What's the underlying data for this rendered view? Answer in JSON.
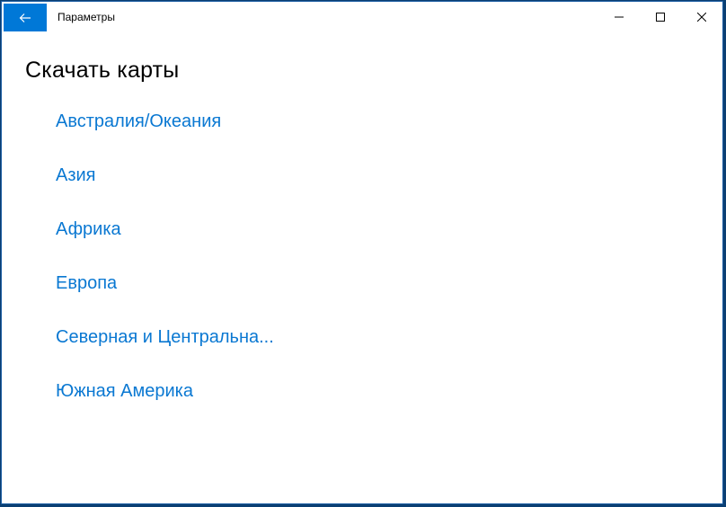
{
  "window": {
    "title": "Параметры",
    "accent_color": "#0078d7",
    "link_color": "#0a78d2"
  },
  "icons": {
    "back": "arrow-left-icon",
    "minimize": "minimize-icon",
    "maximize": "maximize-icon",
    "close": "close-icon"
  },
  "page": {
    "title": "Скачать карты"
  },
  "regions": [
    {
      "label": "Австралия/Океания"
    },
    {
      "label": "Азия"
    },
    {
      "label": "Африка"
    },
    {
      "label": "Европа"
    },
    {
      "label": "Северная и Центральна..."
    },
    {
      "label": "Южная Америка"
    }
  ]
}
